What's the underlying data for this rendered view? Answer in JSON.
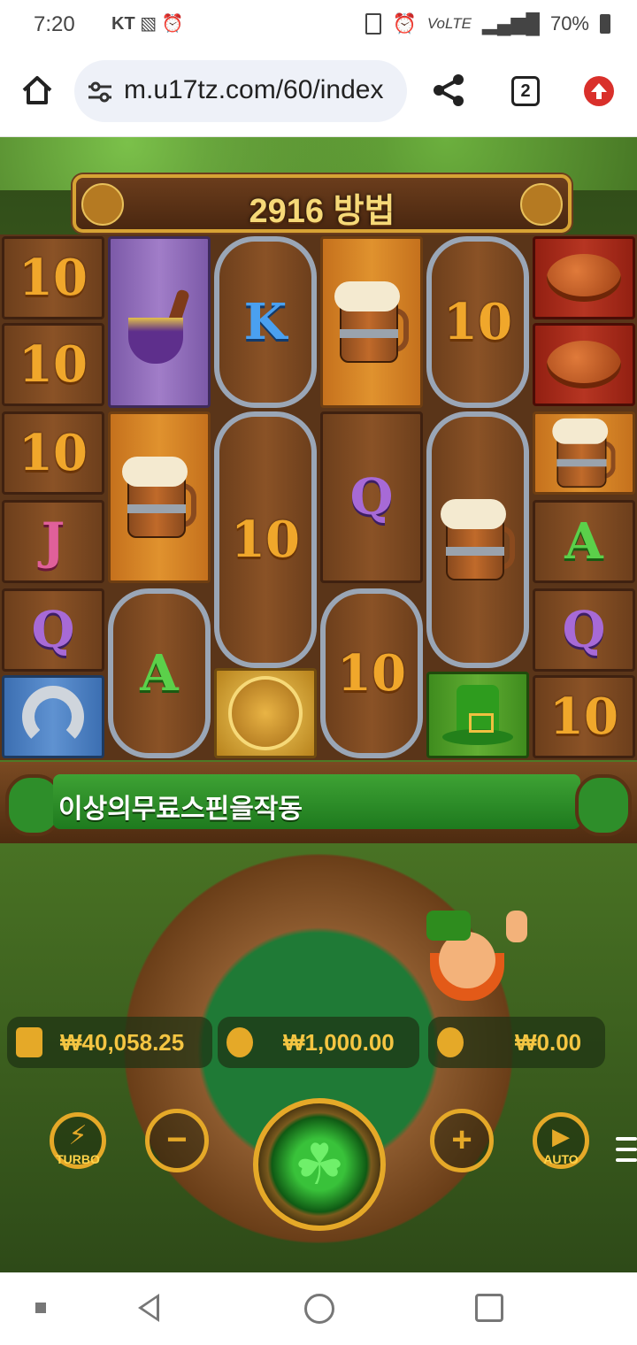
{
  "status_bar": {
    "time": "7:20",
    "carrier": "KT",
    "battery": "70%",
    "network": "VoLTE"
  },
  "browser": {
    "url": "m.u17tz.com/60/index",
    "tab_count": "2"
  },
  "game": {
    "ways_title": "2916  방법",
    "message": "이상의무료스핀을작동",
    "balance": "₩40,058.25",
    "bet": "₩1,000.00",
    "win": "₩0.00",
    "turbo_label": "TURBO",
    "auto_label": "AUTO",
    "reels": [
      [
        "10",
        "10",
        "10",
        "J",
        "Q",
        "horseshoe"
      ],
      [
        "pipe",
        "beer-mug",
        "A"
      ],
      [
        "K",
        "10",
        "chest"
      ],
      [
        "beer-mug",
        "Q",
        "10"
      ],
      [
        "10",
        "beer-mug",
        "hat"
      ],
      [
        "bread",
        "bread",
        "beer-mug",
        "A",
        "Q",
        "10"
      ]
    ]
  },
  "colors": {
    "accent_gold": "#e5a928",
    "value_gold": "#f4c542",
    "banner_green": "#3ea234"
  }
}
